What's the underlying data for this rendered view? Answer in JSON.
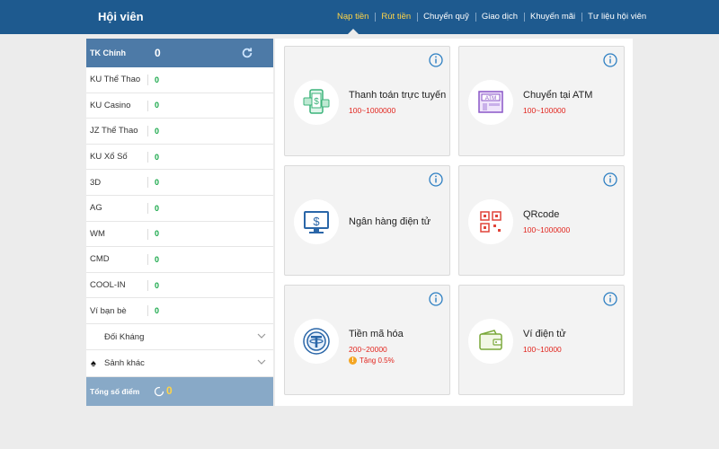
{
  "header": {
    "title": "Hội viên",
    "nav": [
      {
        "label": "Nạp tiền",
        "active": true
      },
      {
        "label": "Rút tiền",
        "highlight": true
      },
      {
        "label": "Chuyển quỹ"
      },
      {
        "label": "Giao dịch"
      },
      {
        "label": "Khuyến mãi"
      },
      {
        "label": "Tư liệu hội viên"
      }
    ]
  },
  "sidebar": {
    "main_account": {
      "label": "TK Chính",
      "value": "0"
    },
    "accounts": [
      {
        "label": "KU Thể Thao",
        "value": "0"
      },
      {
        "label": "KU Casino",
        "value": "0"
      },
      {
        "label": "JZ Thể Thao",
        "value": "0"
      },
      {
        "label": "KU Xổ Số",
        "value": "0"
      },
      {
        "label": "3D",
        "value": "0"
      },
      {
        "label": "AG",
        "value": "0"
      },
      {
        "label": "WM",
        "value": "0"
      },
      {
        "label": "CMD",
        "value": "0"
      },
      {
        "label": "COOL-IN",
        "value": "0"
      },
      {
        "label": "Ví bạn bè",
        "value": "0"
      }
    ],
    "expandables": [
      {
        "label": "Đối Kháng",
        "icon": ""
      },
      {
        "label": "Sảnh khác",
        "icon": "spade-icon"
      }
    ],
    "total": {
      "label": "Tổng số điểm",
      "value": "0"
    }
  },
  "methods": [
    {
      "title": "Thanh toán trực tuyến",
      "range": "100~1000000",
      "icon": "online-payment-icon"
    },
    {
      "title": "Chuyển tại ATM",
      "range": "100~100000",
      "icon": "atm-icon"
    },
    {
      "title": "Ngân hàng điện tử",
      "range": "",
      "icon": "ebank-icon"
    },
    {
      "title": "QRcode",
      "range": "100~1000000",
      "icon": "qrcode-icon"
    },
    {
      "title": "Tiền mã hóa",
      "range": "200~20000",
      "bonus": "Tặng 0.5%",
      "icon": "crypto-icon"
    },
    {
      "title": "Ví điện tử",
      "range": "100~10000",
      "icon": "ewallet-icon"
    }
  ],
  "colors": {
    "header": "#1e5a8f",
    "accent": "#ffd447",
    "positive": "#19a84a",
    "range": "#e2251e",
    "info": "#2d7fc2"
  }
}
